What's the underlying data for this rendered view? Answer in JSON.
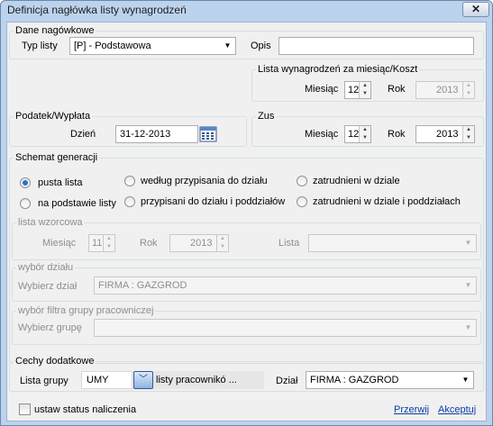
{
  "window": {
    "title": "Definicja nagłówka listy wynagrodzeń",
    "close_glyph": "✕"
  },
  "dane": {
    "title": "Dane nagówkowe",
    "typ_label": "Typ listy",
    "typ_value": "[P] - Podstawowa",
    "opis_label": "Opis",
    "opis_value": ""
  },
  "lista_wyn": {
    "title": "Lista wynagrodzeń za miesiąc/Koszt",
    "miesiac_label": "Miesiąc",
    "miesiac_value": "12",
    "rok_label": "Rok",
    "rok_value": "2013"
  },
  "podatek": {
    "title": "Podatek/Wypłata",
    "dzien_label": "Dzień",
    "dzien_value": "31-12-2013"
  },
  "zus": {
    "title": "Zus",
    "miesiac_label": "Miesiąc",
    "miesiac_value": "12",
    "rok_label": "Rok",
    "rok_value": "2013"
  },
  "schemat": {
    "title": "Schemat generacji",
    "options": [
      {
        "label": "pusta lista",
        "selected": true
      },
      {
        "label": "według przypisania do działu",
        "selected": false
      },
      {
        "label": "zatrudnieni w dziale",
        "selected": false
      },
      {
        "label": "na podstawie listy",
        "selected": false
      },
      {
        "label": "przypisani do działu i poddziałów",
        "selected": false
      },
      {
        "label": "zatrudnieni w dziale i poddziałach",
        "selected": false
      }
    ],
    "wzorcowa": {
      "title": "lista wzorcowa",
      "miesiac_label": "Miesiąc",
      "miesiac_value": "11",
      "rok_label": "Rok",
      "rok_value": "2013",
      "lista_label": "Lista",
      "lista_value": ""
    },
    "dzial": {
      "title": "wybór działu",
      "label": "Wybierz dział",
      "value": "FIRMA : GAZGROD"
    },
    "grupa": {
      "title": "wybór filtra grupy pracowniczej",
      "label": "Wybierz grupę",
      "value": ""
    }
  },
  "cechy": {
    "title": "Cechy dodatkowe",
    "lista_grupy_label": "Lista grupy",
    "lista_grupy_value": "UMY",
    "lista_pracownikow": "listy pracownikó ...",
    "dzial_label": "Dział",
    "dzial_value": "FIRMA : GAZGROD"
  },
  "footer": {
    "status_label": "ustaw status naliczenia",
    "przerwij": "Przerwij",
    "akceptuj": "Akceptuj"
  },
  "colors": {
    "frame": "#bcd3ee",
    "panel": "#f0f0f0",
    "link": "#0b3da8",
    "radio_dot": "#2c70c8"
  }
}
